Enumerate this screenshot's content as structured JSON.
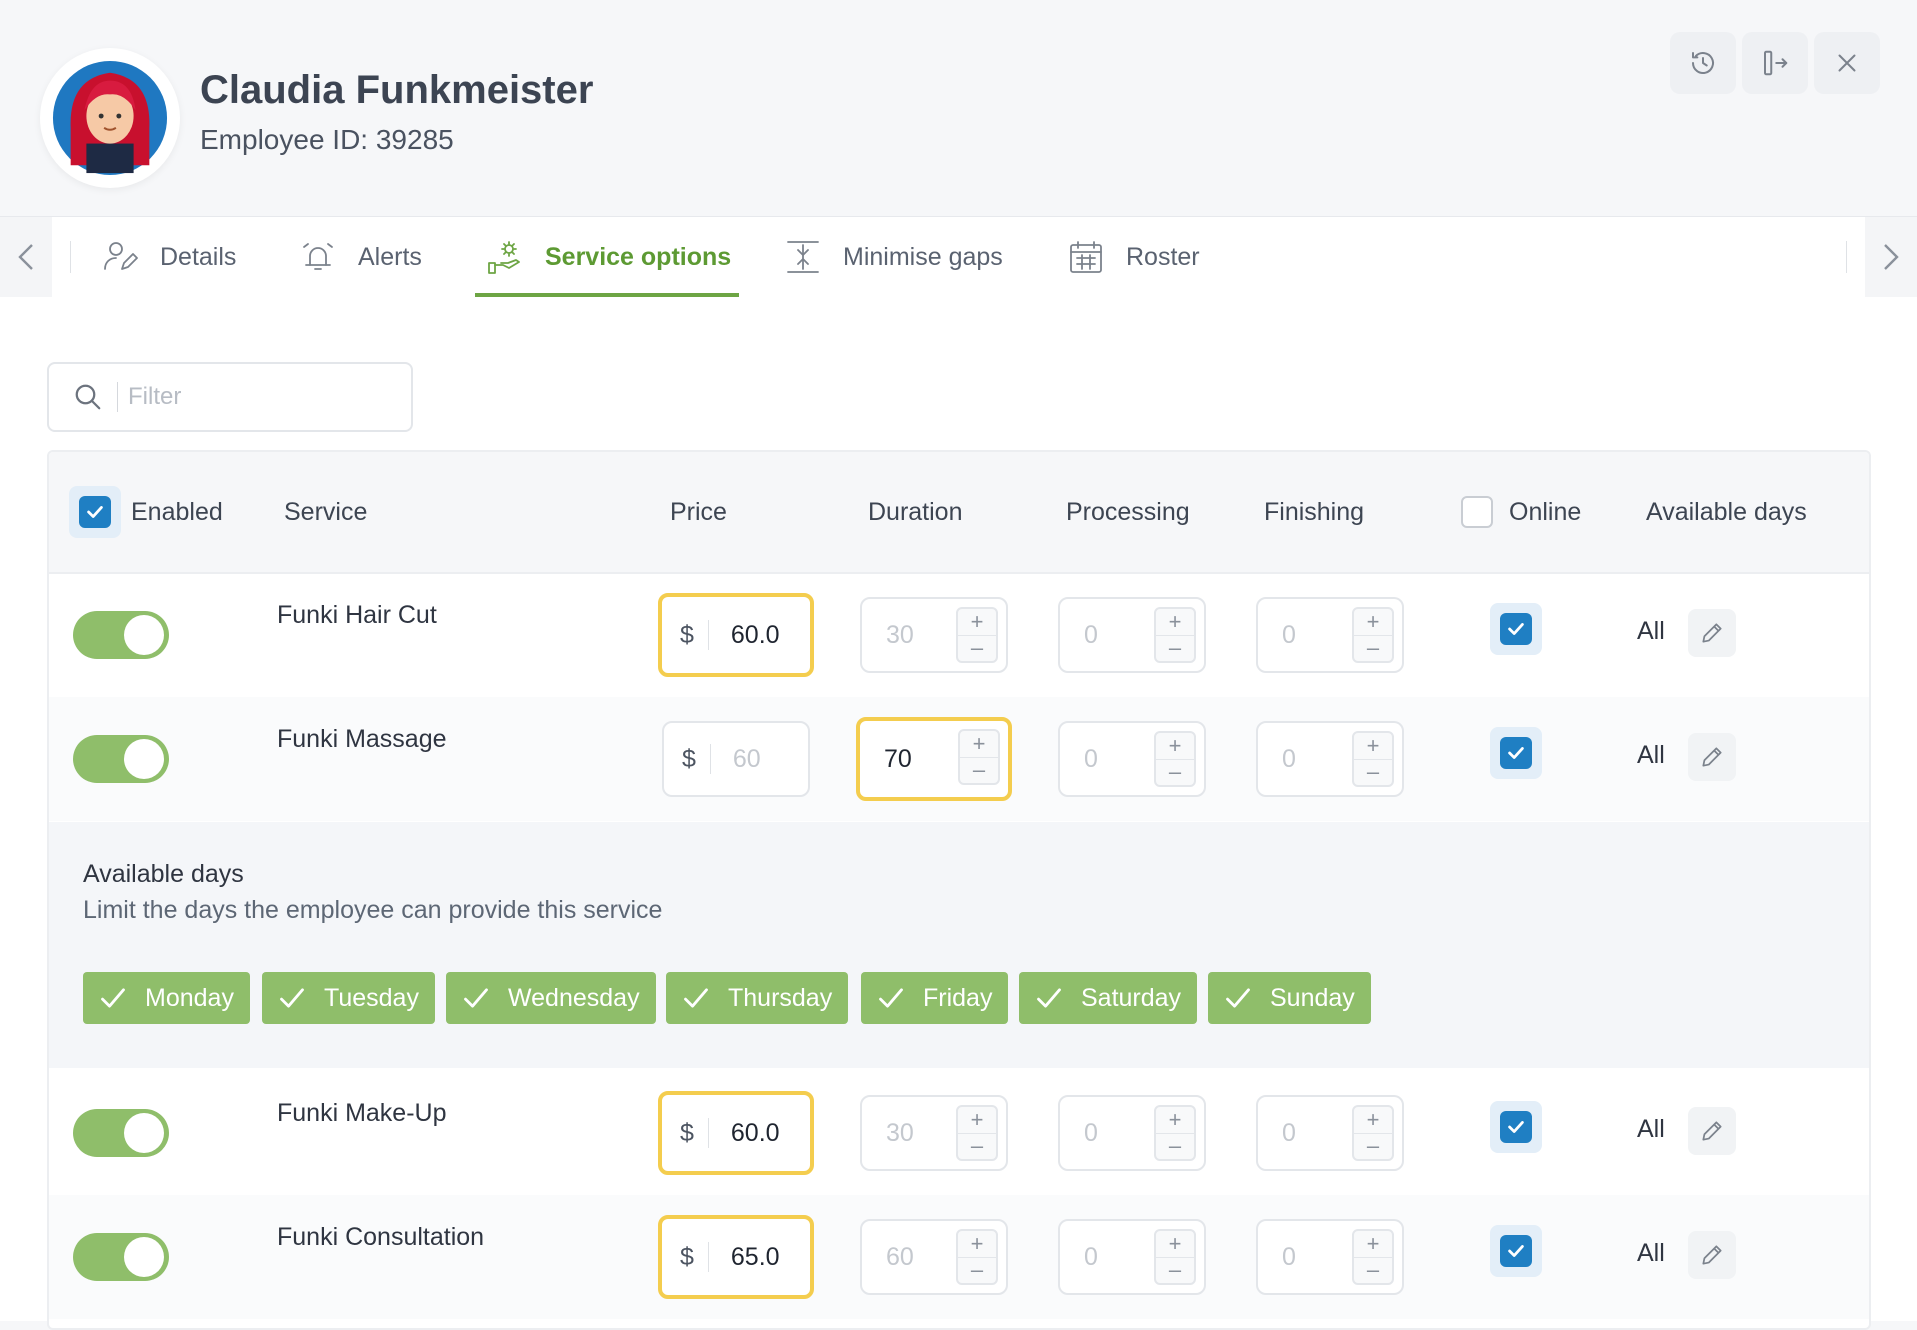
{
  "header": {
    "name": "Claudia Funkmeister",
    "employee_id": "Employee ID: 39285",
    "icons": [
      "history-icon",
      "logout-icon",
      "close-icon"
    ]
  },
  "tabs": [
    {
      "label": "Details",
      "icon": "user-edit-icon",
      "active": false
    },
    {
      "label": "Alerts",
      "icon": "alarm-icon",
      "active": false
    },
    {
      "label": "Service options",
      "icon": "service-hand-gear-icon",
      "active": true
    },
    {
      "label": "Minimise gaps",
      "icon": "compress-vertical-icon",
      "active": false
    },
    {
      "label": "Roster",
      "icon": "calendar-icon",
      "active": false
    }
  ],
  "filter": {
    "placeholder": "Filter"
  },
  "table": {
    "columns": {
      "enabled": "Enabled",
      "service": "Service",
      "price": "Price",
      "duration": "Duration",
      "processing": "Processing",
      "finishing": "Finishing",
      "online": "Online",
      "available_days": "Available days"
    },
    "enabled_all": true,
    "online_all": false,
    "rows": [
      {
        "enabled": true,
        "service": "Funki Hair Cut",
        "currency": "$",
        "price": "60.0",
        "duration": "30",
        "processing": "0",
        "finishing": "0",
        "online": true,
        "available": "All"
      },
      {
        "enabled": true,
        "service": "Funki Massage",
        "currency": "$",
        "price": "60",
        "duration": "70",
        "processing": "0",
        "finishing": "0",
        "online": true,
        "available": "All"
      },
      {
        "enabled": true,
        "service": "Funki Make-Up",
        "currency": "$",
        "price": "60.0",
        "duration": "30",
        "processing": "0",
        "finishing": "0",
        "online": true,
        "available": "All"
      },
      {
        "enabled": true,
        "service": "Funki Consultation",
        "currency": "$",
        "price": "65.0",
        "duration": "60",
        "processing": "0",
        "finishing": "0",
        "online": true,
        "available": "All"
      }
    ]
  },
  "available_days_panel": {
    "title": "Available days",
    "subtitle": "Limit the days the employee can provide this service",
    "days": [
      "Monday",
      "Tuesday",
      "Wednesday",
      "Thursday",
      "Friday",
      "Saturday",
      "Sunday"
    ]
  },
  "colors": {
    "accent_green": "#6da544",
    "chip_green": "#8fbe6a",
    "checkbox_blue": "#1f7fc3",
    "highlight_yellow": "#f4cd4e"
  }
}
